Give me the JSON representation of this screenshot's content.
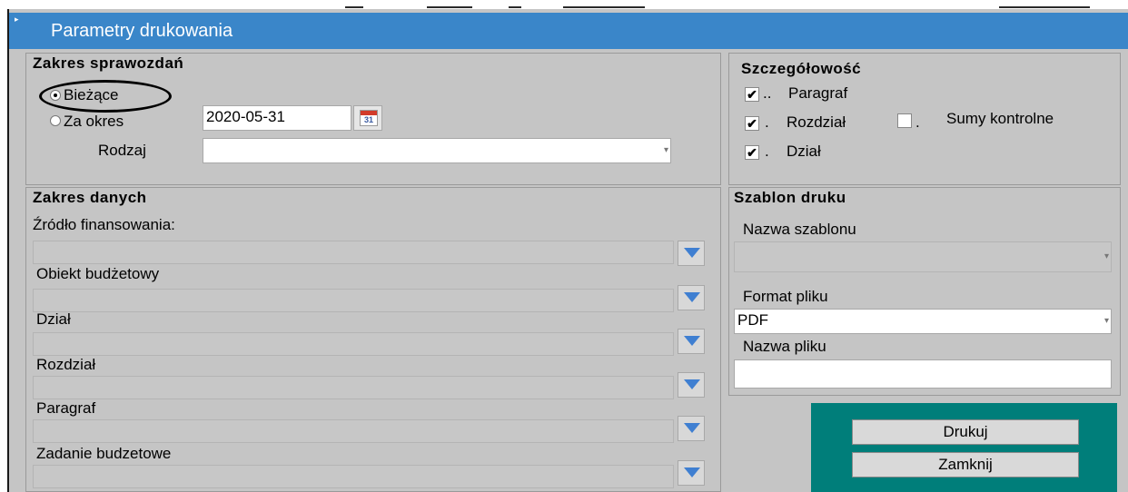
{
  "window": {
    "title": "Parametry drukowania",
    "icon": "app-icon"
  },
  "zakres_sprawozdan": {
    "heading": "Zakres sprawozdań",
    "option_current": "Bieżące",
    "option_period": "Za okres",
    "date_value": "2020-05-31",
    "calendar_day": "31",
    "rodzaj_label": "Rodzaj",
    "rodzaj_value": "",
    "selected_option": "Bieżące"
  },
  "szczegolowosc": {
    "heading": "Szczegółowość",
    "paragraf": {
      "label": "Paragraf",
      "checked": true
    },
    "rozdzial": {
      "label": "Rozdział",
      "checked": true
    },
    "dzial": {
      "label": "Dział",
      "checked": true
    },
    "sumy": {
      "label": "Sumy kontrolne",
      "checked": false
    }
  },
  "zakres_danych": {
    "heading": "Zakres danych",
    "fields": [
      {
        "label": "Źródło finansowania:",
        "value": ""
      },
      {
        "label": "Obiekt budżetowy",
        "value": ""
      },
      {
        "label": "Dział",
        "value": ""
      },
      {
        "label": "Rozdział",
        "value": ""
      },
      {
        "label": "Paragraf",
        "value": ""
      },
      {
        "label": "Zadanie budzetowe",
        "value": ""
      }
    ]
  },
  "szablon_druku": {
    "heading": "Szablon druku",
    "nazwa_szablonu_label": "Nazwa szablonu",
    "nazwa_szablonu_value": "",
    "format_label": "Format pliku",
    "format_value": "PDF",
    "nazwa_pliku_label": "Nazwa pliku",
    "nazwa_pliku_value": ""
  },
  "actions": {
    "print_label": "Drukuj",
    "close_label": "Zamknij"
  },
  "colors": {
    "titlebar": "#3a86c9",
    "background": "#c5c5c5",
    "action_panel": "#007e7a",
    "dropdown_arrow": "#3f7fd1"
  }
}
